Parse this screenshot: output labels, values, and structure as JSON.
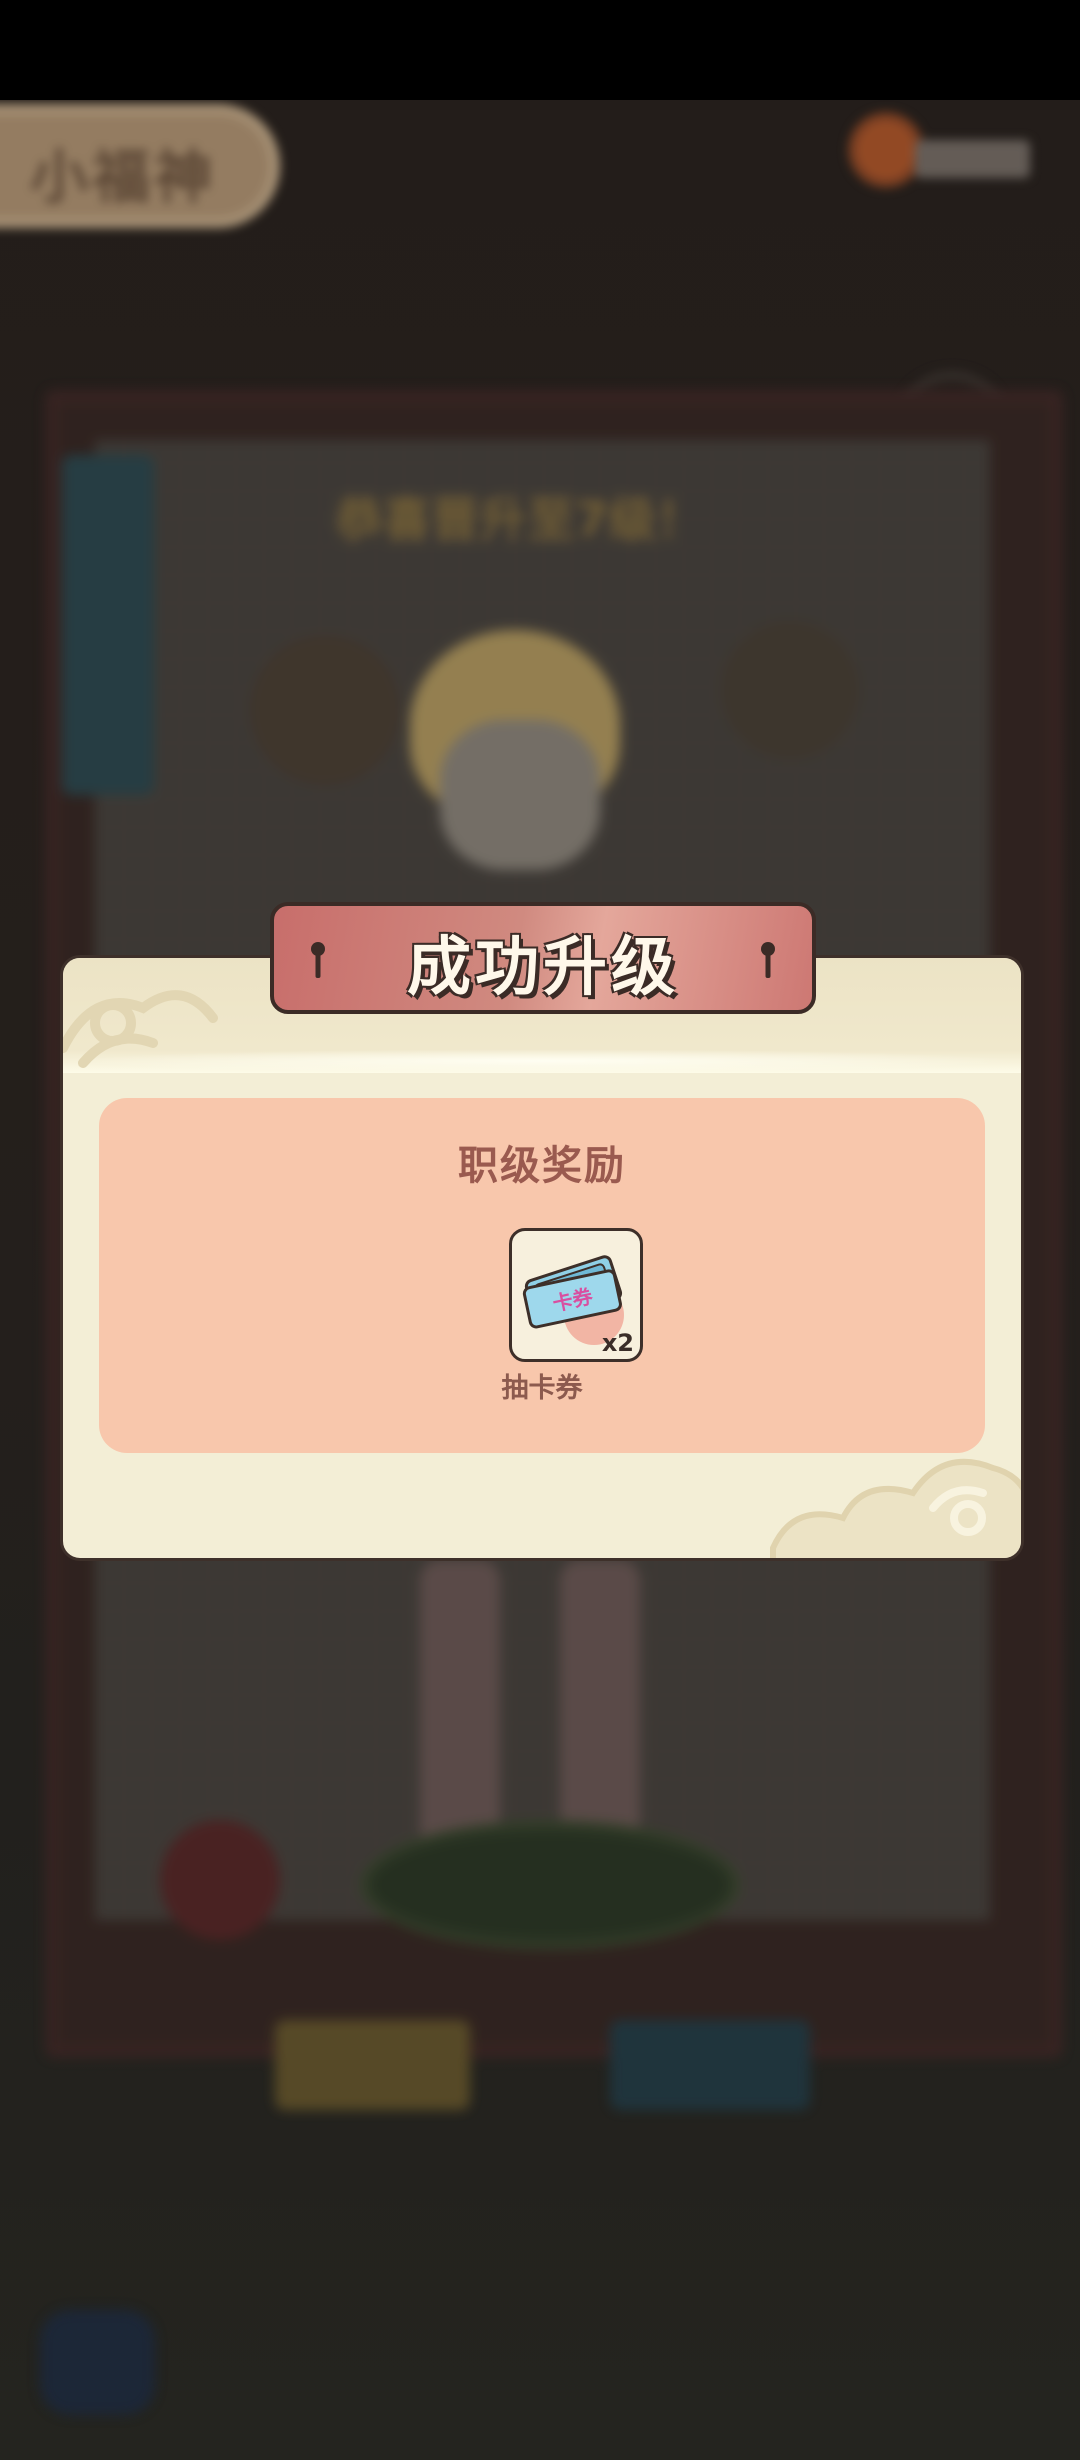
{
  "background": {
    "game_title": "小福神",
    "congrats_text": "恭喜晋升至7级！"
  },
  "dialog": {
    "banner_title": "成功升级",
    "section_title": "职级奖励",
    "reward": {
      "icon_label": "卡券",
      "count": "x2",
      "name": "抽卡券"
    }
  },
  "colors": {
    "dialog_bg": "#f3eed6",
    "card_bg": "#f8c7ac",
    "banner_red": "#c86e6b",
    "title_text": "#9a5a4f"
  }
}
